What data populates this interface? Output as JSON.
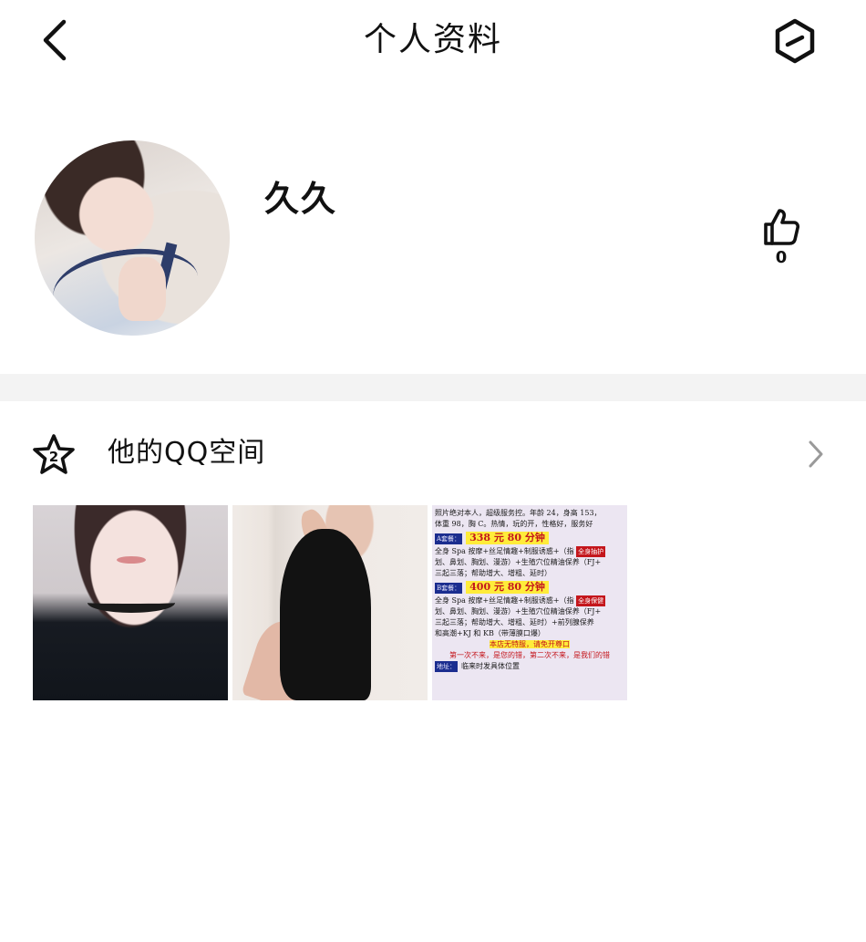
{
  "nav": {
    "title": "个人资料",
    "back_icon": "chevron-left-icon",
    "more_icon": "hexagon-minus-icon"
  },
  "profile": {
    "name": "久久",
    "like_icon": "thumbs-up-icon",
    "like_count": "0"
  },
  "qzone": {
    "icon": "star-level-icon",
    "icon_badge": "2",
    "label": "他的QQ空间",
    "arrow_icon": "chevron-right-icon",
    "photos": [
      {
        "kind": "selfie"
      },
      {
        "kind": "black-dress"
      },
      {
        "kind": "text-ad",
        "lines": [
          "照片绝对本人，超级服务控。年龄 24，身高 153，",
          "体重 98，胸 C。热情，玩的开，性格好，服务好",
          "338 元 80 分钟",
          "全身 Spa 按摩+丝足情趣+制服诱惑+（指",
          "划、鼻划、胸划、漫游）+生殖穴位精油保养（FJ+",
          "三起三落；帮助增大、增粗、延时）",
          "400 元 80 分钟",
          "全身 Spa 按摩+丝足情趣+制服诱惑+（指",
          "划、鼻划、胸划、漫游）+生殖穴位精油保养（FJ+",
          "三起三落；帮助增大、增粗、延时）+前列腺保养",
          "和高潮+KJ 和 KB（带薄膜口爆）",
          "本店无特服，请免开尊口",
          "第一次不来，是您的错，第二次不来，是我们的错",
          "地址：",
          "临来时发具体位置"
        ],
        "tags": [
          "A套餐：",
          "B套餐：",
          "全身抽护",
          "全身保健"
        ]
      }
    ]
  },
  "colors": {
    "text": "#111111",
    "divider": "#f3f3f3",
    "arrow": "#9a9a9a",
    "ad_price_red": "#c4161c",
    "ad_highlight_yellow": "#ffec3a"
  }
}
